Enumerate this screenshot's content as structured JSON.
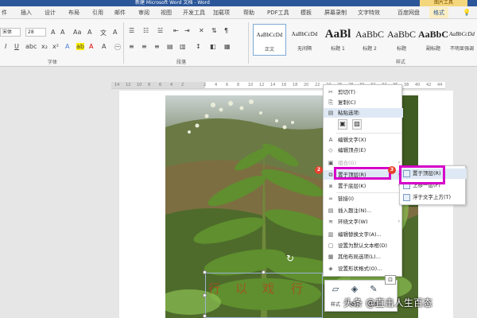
{
  "window": {
    "title": "新建 Microsoft Word 文档 - Word",
    "context_tab_header": "图片工具"
  },
  "tabs": [
    "件",
    "插入",
    "设计",
    "布局",
    "引用",
    "邮件",
    "审阅",
    "视图",
    "开发工具",
    "加载项",
    "帮助",
    "PDF工具",
    "模板",
    "屏幕录制",
    "文字特效",
    "百度网盘",
    "格式"
  ],
  "ribbon": {
    "font_name": "宋体",
    "font_size": "28",
    "groups": {
      "font": "字体",
      "paragraph": "段落",
      "styles": "样式"
    },
    "styles": [
      {
        "sample": "AaBbCcDd",
        "name": "正文"
      },
      {
        "sample": "AaBbCcDd",
        "name": "无间隔"
      },
      {
        "sample": "AaBl",
        "name": "标题 1"
      },
      {
        "sample": "AaBbC",
        "name": "标题 2"
      },
      {
        "sample": "AaBbC",
        "name": "标题"
      },
      {
        "sample": "AaBbC",
        "name": "副标题"
      },
      {
        "sample": "AaBbCcDd",
        "name": "不明显强调"
      }
    ]
  },
  "ruler_ticks": [
    "14",
    "12",
    "10",
    "8",
    "6",
    "4",
    "2",
    "",
    "2",
    "4",
    "6",
    "8",
    "10",
    "12",
    "14",
    "16",
    "18",
    "20",
    "22",
    "24",
    "26",
    "28",
    "30",
    "32",
    "34",
    "36",
    "38",
    "40",
    "42",
    "44"
  ],
  "context_menu": {
    "items": [
      {
        "icon": "scissors-icon",
        "glyph": "✂",
        "label": "剪切(T)",
        "disabled": false
      },
      {
        "icon": "copy-icon",
        "glyph": "⎘",
        "label": "复制(C)",
        "disabled": false
      },
      {
        "icon": "paste-icon",
        "glyph": "📋",
        "label": "粘贴选项:",
        "disabled": false,
        "highlight": true
      },
      {
        "icon": "edit-text-icon",
        "glyph": "A",
        "label": "编辑文字(X)",
        "disabled": false
      },
      {
        "icon": "edit-vertices-icon",
        "glyph": "◇",
        "label": "编辑顶点(E)",
        "disabled": false
      },
      {
        "icon": "group-icon",
        "glyph": "▣",
        "label": "组合(G)",
        "disabled": true,
        "arrow": "›"
      },
      {
        "icon": "bring-front-icon",
        "glyph": "⧉",
        "label": "置于顶层(R)",
        "disabled": false,
        "arrow": "›",
        "highlight": true
      },
      {
        "icon": "send-back-icon",
        "glyph": "⧈",
        "label": "置于底层(K)",
        "disabled": false,
        "arrow": "›"
      },
      {
        "icon": "link-icon",
        "glyph": "🔗",
        "label": "链接(I)",
        "disabled": false
      },
      {
        "icon": "caption-icon",
        "glyph": "▤",
        "label": "插入题注(N)...",
        "disabled": false
      },
      {
        "icon": "wrap-text-icon",
        "glyph": "≋",
        "label": "环绕文字(W)",
        "disabled": false,
        "arrow": "›"
      },
      {
        "icon": "alt-text-icon",
        "glyph": "▥",
        "label": "编辑替换文字(A)...",
        "disabled": false
      },
      {
        "icon": "default-textbox-icon",
        "glyph": "▢",
        "label": "设置为默认文本框(D)",
        "disabled": false
      },
      {
        "icon": "more-layout-icon",
        "glyph": "▦",
        "label": "其他布局选项(L)...",
        "disabled": false
      },
      {
        "icon": "format-shape-icon",
        "glyph": "◈",
        "label": "设置形状格式(O)...",
        "disabled": false
      }
    ]
  },
  "submenu": {
    "items": [
      {
        "label": "置于顶层(R)",
        "highlight": true
      },
      {
        "label": "上移一层(F)",
        "highlight": false
      },
      {
        "label": "浮于文字上方(T)",
        "highlight": false
      }
    ]
  },
  "steps": {
    "first": "2",
    "second": "3"
  },
  "mini_toolbar": {
    "style_label": "样式",
    "fill_label": "填充",
    "outline_label": "轮廓"
  },
  "wordart_text": [
    "行",
    "以",
    "戏",
    "行"
  ],
  "watermark": "头条 @直击人生百态",
  "colors": {
    "brand": "#2b579a",
    "highlight_box": "#d600c9",
    "badge": "#e8402f"
  }
}
